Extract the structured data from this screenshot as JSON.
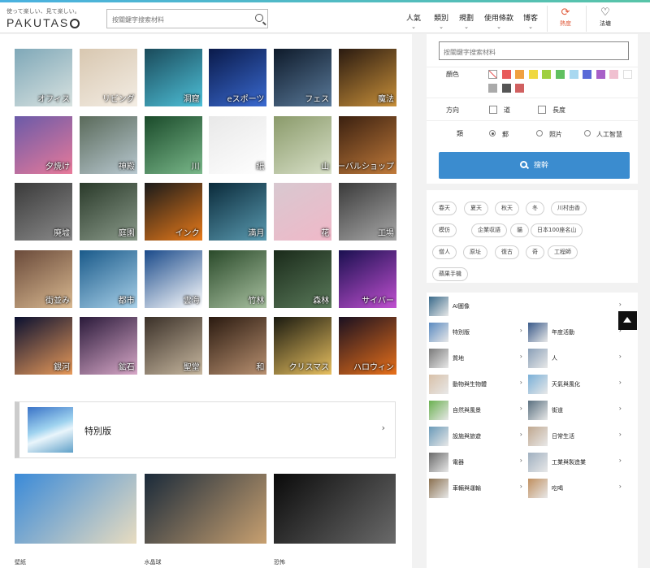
{
  "header": {
    "tagline": "使って楽しい、見て楽しい。",
    "brand": "PAKUTAS",
    "search_placeholder": "按關鍵字搜索材料",
    "nav": [
      "人氣",
      "類別",
      "規劃",
      "使用條款",
      "博客"
    ],
    "update_label": "熱度",
    "fav_label": "法塘"
  },
  "tiles": [
    {
      "label": "オフィス",
      "c1": "#7fa8b8",
      "c2": "#d8e2e0"
    },
    {
      "label": "リビング",
      "c1": "#d8c7b0",
      "c2": "#f3ede4"
    },
    {
      "label": "洞窟",
      "c1": "#1a4a5a",
      "c2": "#4ec0d8"
    },
    {
      "label": "eスポーツ",
      "c1": "#0a1a4a",
      "c2": "#3a6ad0"
    },
    {
      "label": "フェス",
      "c1": "#0e1a2a",
      "c2": "#5a7a9a"
    },
    {
      "label": "魔法",
      "c1": "#2a1a10",
      "c2": "#c8903a"
    },
    {
      "label": "夕焼け",
      "c1": "#6a5aa8",
      "c2": "#e87a9a"
    },
    {
      "label": "神殿",
      "c1": "#5a6a5a",
      "c2": "#b8c8d0"
    },
    {
      "label": "川",
      "c1": "#1a4a2a",
      "c2": "#7ab88a"
    },
    {
      "label": "紙",
      "c1": "#e8e8e8",
      "c2": "#ffffff"
    },
    {
      "label": "山",
      "c1": "#8a9a6a",
      "c2": "#d8e0c8"
    },
    {
      "label": "ハーバルショップ",
      "c1": "#3a2010",
      "c2": "#c07a3a"
    },
    {
      "label": "廃墟",
      "c1": "#3a3a3a",
      "c2": "#8a8a8a"
    },
    {
      "label": "庭園",
      "c1": "#2a3a2a",
      "c2": "#8a9a8a"
    },
    {
      "label": "インク",
      "c1": "#1a1a1a",
      "c2": "#e87a1a"
    },
    {
      "label": "満月",
      "c1": "#0a2a3a",
      "c2": "#5a9ab0"
    },
    {
      "label": "花",
      "c1": "#d8c8d0",
      "c2": "#f0b8c8"
    },
    {
      "label": "工場",
      "c1": "#3a3a3a",
      "c2": "#a8a8a8"
    },
    {
      "label": "街並み",
      "c1": "#6a4a3a",
      "c2": "#d8b890"
    },
    {
      "label": "都市",
      "c1": "#1a5a8a",
      "c2": "#a8d0e8"
    },
    {
      "label": "雲海",
      "c1": "#1a4a8a",
      "c2": "#ffffff"
    },
    {
      "label": "竹林",
      "c1": "#2a4a2a",
      "c2": "#a8c0a0"
    },
    {
      "label": "森林",
      "c1": "#1a2a1a",
      "c2": "#5a7a5a"
    },
    {
      "label": "サイバー",
      "c1": "#1a1050",
      "c2": "#c050d0"
    },
    {
      "label": "銀河",
      "c1": "#0a1030",
      "c2": "#e89a5a"
    },
    {
      "label": "鉱石",
      "c1": "#2a1a3a",
      "c2": "#d8a8c8"
    },
    {
      "label": "聖堂",
      "c1": "#3a3028",
      "c2": "#c8b8a0"
    },
    {
      "label": "和",
      "c1": "#2a1a10",
      "c2": "#b89070"
    },
    {
      "label": "クリスマス",
      "c1": "#1a1a10",
      "c2": "#e8c060"
    },
    {
      "label": "ハロウィン",
      "c1": "#1a1020",
      "c2": "#e8701a"
    }
  ],
  "special": {
    "label": "特別版",
    "arrow": "›"
  },
  "cards": [
    {
      "caption": "壁紙",
      "c1": "#3a8ad8",
      "c2": "#e8dcc0"
    },
    {
      "caption": "水晶球",
      "c1": "#1a2a3a",
      "c2": "#c8a070"
    },
    {
      "caption": "恐怖",
      "c1": "#0a0a0a",
      "c2": "#6a6a6a"
    }
  ],
  "search": {
    "placeholder": "按關鍵字搜索材料",
    "color_label": "顏色",
    "colors": [
      "#e85a5a",
      "#f0a040",
      "#f0d840",
      "#a0d040",
      "#60c060",
      "#a8d8f0",
      "#5a6ad8",
      "#a860c8",
      "#f0c0d0",
      "#ffffff",
      "#aaaaaa",
      "#555555",
      "#d06060"
    ],
    "direction_label": "方向",
    "dir_options": [
      "道",
      "長度"
    ],
    "type_label": "類",
    "type_options": [
      "郵",
      "照片",
      "人工智慧"
    ],
    "button_label": "搜幹"
  },
  "tags": [
    "春天",
    "夏天",
    "秋天",
    "冬",
    "川村由香",
    "模仿",
    "企業収語",
    "貓",
    "日本100座名山",
    "僧人",
    "原址",
    "復古",
    "奇",
    "工程師",
    "蘋果手機"
  ],
  "categories": [
    {
      "label": "AI圖像",
      "c": "#3a6a8a",
      "full": true
    },
    {
      "label": "特別版",
      "c": "#5a8ac0"
    },
    {
      "label": "年度活動",
      "c": "#3a5a8a"
    },
    {
      "label": "質地",
      "c": "#7a7a7a"
    },
    {
      "label": "人",
      "c": "#8aa0b8"
    },
    {
      "label": "動物與生物體",
      "c": "#d8c0a8"
    },
    {
      "label": "天氣與風化",
      "c": "#7ab0d8"
    },
    {
      "label": "自然與風景",
      "c": "#6ab050"
    },
    {
      "label": "街道",
      "c": "#5a7080"
    },
    {
      "label": "設施與旅遊",
      "c": "#6a9ab8"
    },
    {
      "label": "日常生活",
      "c": "#c0a890"
    },
    {
      "label": "電器",
      "c": "#6a6a6a"
    },
    {
      "label": "工業與製造業",
      "c": "#a0b0c0"
    },
    {
      "label": "車輛與運輸",
      "c": "#8a7050"
    },
    {
      "label": "吃喝",
      "c": "#c09060"
    }
  ],
  "arrow": "›"
}
